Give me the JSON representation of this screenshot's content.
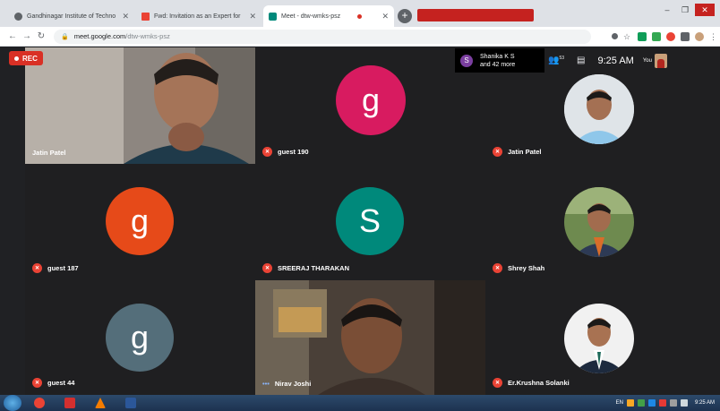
{
  "browser": {
    "tabs": [
      {
        "title": "Gandhinagar Institute of Techno",
        "fav_color": "#5f6368"
      },
      {
        "title": "Fwd: Invitation as an Expert for",
        "fav_color": "#ea4335"
      },
      {
        "title": "Meet - dtw-wmks-psz",
        "fav_color": "#00897b"
      }
    ],
    "url_host": "meet.google.com",
    "url_path": "/dtw-wmks-psz"
  },
  "meet": {
    "rec_label": "REC",
    "participants_popup": {
      "initial": "S",
      "line1": "Shanika K S",
      "line2": "and 42 more"
    },
    "participant_count": "53",
    "time": "9:25 AM",
    "self_label": "You",
    "tiles": [
      {
        "name": "Jatin Patel",
        "kind": "video"
      },
      {
        "name": "guest 190",
        "kind": "avatar",
        "letter": "g",
        "color": "#d81b60"
      },
      {
        "name": "Jatin Patel",
        "kind": "photo"
      },
      {
        "name": "guest 187",
        "kind": "avatar",
        "letter": "g",
        "color": "#e64a19"
      },
      {
        "name": "SREERAJ THARAKAN",
        "kind": "avatar",
        "letter": "S",
        "color": "#00897b"
      },
      {
        "name": "Shrey Shah",
        "kind": "photo"
      },
      {
        "name": "guest 44",
        "kind": "avatar",
        "letter": "g",
        "color": "#546e7a"
      },
      {
        "name": "Nirav Joshi",
        "kind": "video"
      },
      {
        "name": "Er.Krushna Solanki",
        "kind": "photo"
      }
    ]
  },
  "taskbar": {
    "lang": "EN",
    "clock_time": "9:25 AM"
  }
}
